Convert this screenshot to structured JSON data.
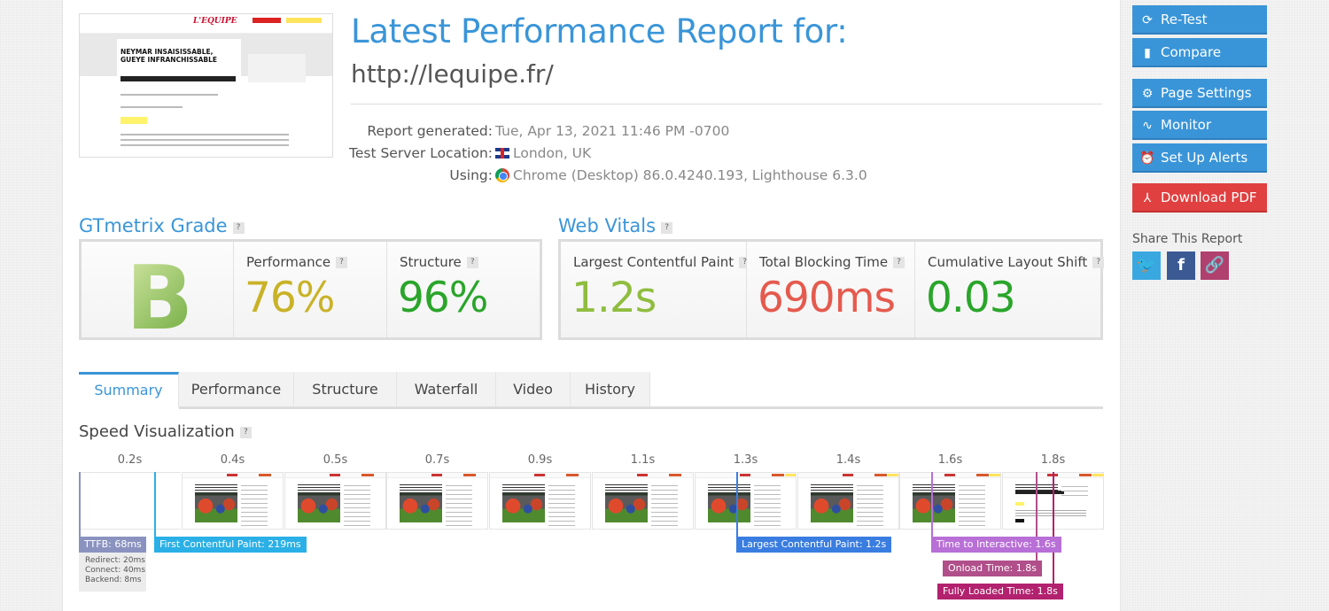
{
  "header": {
    "title": "Latest Performance Report for:",
    "url": "http://lequipe.fr/"
  },
  "thumbnail": {
    "site_logo": "L'EQUIPE",
    "headline": "NEYMAR INSAISISSABLE, GUEYE INFRANCHISSABLE"
  },
  "report_info": {
    "generated_label": "Report generated:",
    "generated_value": "Tue, Apr 13, 2021 11:46 PM -0700",
    "location_label": "Test Server Location:",
    "location_icon": "uk-flag-icon",
    "location_value": "London, UK",
    "using_label": "Using:",
    "using_icon": "chrome-icon",
    "using_value": "Chrome (Desktop) 86.0.4240.193, Lighthouse 6.3.0"
  },
  "gtmetrix_grade": {
    "heading": "GTmetrix Grade",
    "help": "?",
    "grade": "B",
    "performance_label": "Performance",
    "performance_value": "76%",
    "structure_label": "Structure",
    "structure_value": "96%",
    "colors": {
      "grade": "#8bc34a",
      "performance": "#c9b227",
      "structure": "#2aa52a"
    }
  },
  "web_vitals": {
    "heading": "Web Vitals",
    "help": "?",
    "lcp_label": "Largest Contentful Paint",
    "lcp_value": "1.2s",
    "tbt_label": "Total Blocking Time",
    "tbt_value": "690ms",
    "cls_label": "Cumulative Layout Shift",
    "cls_value": "0.03",
    "colors": {
      "lcp": "#8fbd3f",
      "tbt": "#e55a4e",
      "cls": "#2aa52a"
    }
  },
  "tabs": [
    {
      "label": "Summary",
      "active": true
    },
    {
      "label": "Performance",
      "active": false
    },
    {
      "label": "Structure",
      "active": false
    },
    {
      "label": "Waterfall",
      "active": false
    },
    {
      "label": "Video",
      "active": false
    },
    {
      "label": "History",
      "active": false
    }
  ],
  "speed_visualization": {
    "heading": "Speed Visualization",
    "help": "?",
    "frames": [
      "0.2s",
      "0.4s",
      "0.5s",
      "0.7s",
      "0.9s",
      "1.1s",
      "1.3s",
      "1.4s",
      "1.6s",
      "1.8s"
    ],
    "markers": {
      "ttfb": "TTFB: 68ms",
      "fcp": "First Contentful Paint: 219ms",
      "lcp": "Largest Contentful Paint: 1.2s",
      "tti": "Time to Interactive: 1.6s",
      "onload": "Onload Time: 1.8s",
      "fully_loaded": "Fully Loaded Time: 1.8s"
    },
    "ttfb_breakdown": {
      "redirect": "Redirect: 20ms",
      "connect": "Connect: 40ms",
      "backend": "Backend: 8ms"
    },
    "colors": {
      "ttfb": "#8a93bf",
      "fcp": "#2ab0e6",
      "lcp": "#3a7de0",
      "tti": "#b86fd6",
      "onload": "#b04f8a",
      "fully_loaded": "#b2226e"
    }
  },
  "sidebar": {
    "buttons": [
      {
        "label": "Re-Test",
        "icon": "refresh-icon"
      },
      {
        "label": "Compare",
        "icon": "copy-icon"
      },
      {
        "label": "Page Settings",
        "icon": "gear-icon"
      },
      {
        "label": "Monitor",
        "icon": "pulse-icon"
      },
      {
        "label": "Set Up Alerts",
        "icon": "alarm-clock-icon"
      },
      {
        "label": "Download PDF",
        "icon": "pdf-icon"
      }
    ],
    "share_heading": "Share This Report",
    "share": [
      {
        "name": "twitter",
        "glyph": "🐦",
        "color": "#3aa8e0"
      },
      {
        "name": "facebook",
        "glyph": "f",
        "color": "#3b5a93"
      },
      {
        "name": "link",
        "glyph": "🔗",
        "color": "#b0406e"
      }
    ]
  }
}
